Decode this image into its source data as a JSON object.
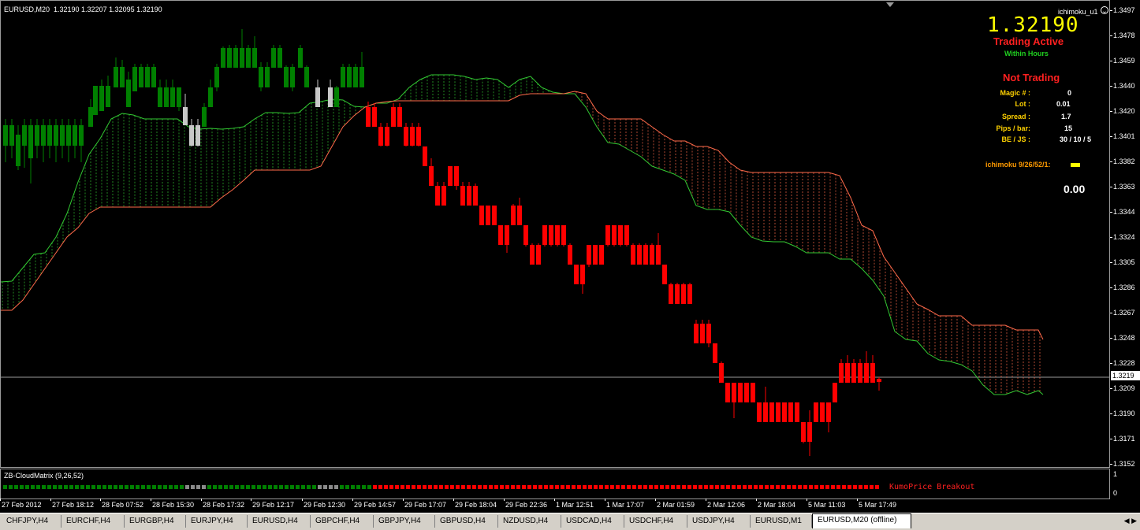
{
  "chart": {
    "symbol_line": "EURUSD,M20  1.32190 1.32207 1.32095 1.32190",
    "indicator_name": "ichimoku_u1",
    "price_ticks": [
      "1.3497",
      "1.3478",
      "1.3459",
      "1.3440",
      "1.3420",
      "1.3401",
      "1.3382",
      "1.3363",
      "1.3344",
      "1.3324",
      "1.3305",
      "1.3286",
      "1.3267",
      "1.3248",
      "1.3228",
      "1.3209",
      "1.3190",
      "1.3171",
      "1.3152"
    ],
    "current_price_label": "1.3219",
    "time_ticks": [
      "27 Feb 2012",
      "27 Feb 18:12",
      "28 Feb 07:52",
      "28 Feb 15:30",
      "28 Feb 17:32",
      "29 Feb 12:17",
      "29 Feb 12:30",
      "29 Feb 14:57",
      "29 Feb 17:07",
      "29 Feb 18:04",
      "29 Feb 22:36",
      "1 Mar 12:51",
      "1 Mar 17:07",
      "2 Mar 01:59",
      "2 Mar 12:06",
      "2 Mar 18:04",
      "5 Mar 11:03",
      "5 Mar 17:49"
    ],
    "colors": {
      "bull": "#008000",
      "bear": "#ff0000",
      "neutral": "#c8c8c8",
      "cloud_up": "#32c832",
      "cloud_down": "#ff6a4a",
      "background": "#000000"
    }
  },
  "panel": {
    "price": "1.32190",
    "trading_active": "Trading Active",
    "within_hours": "Within Hours",
    "not_trading": "Not Trading",
    "stats": [
      {
        "label": "Magic # :",
        "value": "0"
      },
      {
        "label": "Lot :",
        "value": "0.01"
      },
      {
        "label": "Spread :",
        "value": "1.7"
      },
      {
        "label": "Pips / bar:",
        "value": "15"
      },
      {
        "label": "BE / JS :",
        "value": "30 / 10 / 5"
      }
    ],
    "ichimoku_setting": "ichimoku 9/26/52/1:",
    "profit": "0.00"
  },
  "sub_window": {
    "title": "ZB-CloudMatrix (9,26,52)",
    "label": "KumoPrice Breakout",
    "ticks": [
      "1",
      "0"
    ]
  },
  "tabs": [
    {
      "label": "CHFJPY,H4"
    },
    {
      "label": "EURCHF,H4"
    },
    {
      "label": "EURGBP,H4"
    },
    {
      "label": "EURJPY,H4"
    },
    {
      "label": "EURUSD,H4"
    },
    {
      "label": "GBPCHF,H4"
    },
    {
      "label": "GBPJPY,H4"
    },
    {
      "label": "GBPUSD,H4"
    },
    {
      "label": "NZDUSD,H4"
    },
    {
      "label": "USDCAD,H4"
    },
    {
      "label": "USDCHF,H4"
    },
    {
      "label": "USDJPY,H4"
    },
    {
      "label": "EURUSD,M1"
    },
    {
      "label": "EURUSD,M20 (offline)"
    }
  ],
  "active_tab": "EURUSD,M20 (offline)"
}
